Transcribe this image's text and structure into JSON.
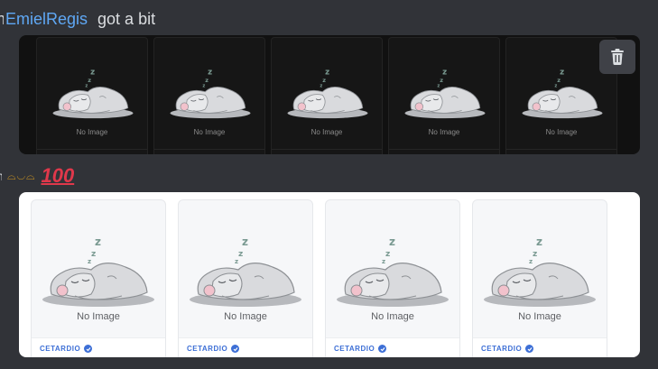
{
  "message1": {
    "fragment": "n",
    "mention": "EmielRegis",
    "text": "got a bit"
  },
  "dark_embed": {
    "cards": [
      {
        "no_image": "No Image"
      },
      {
        "no_image": "No Image"
      },
      {
        "no_image": "No Image"
      },
      {
        "no_image": "No Image"
      },
      {
        "no_image": "No Image"
      }
    ],
    "delete_icon": "trash-icon"
  },
  "message2": {
    "fragment": "n",
    "emote": "⌓◡⌓",
    "emoji": "💯",
    "emoji_fallback": "100"
  },
  "light_embed": {
    "cards": [
      {
        "no_image": "No Image",
        "brand": "CETARDIO"
      },
      {
        "no_image": "No Image",
        "brand": "CETARDIO"
      },
      {
        "no_image": "No Image",
        "brand": "CETARDIO"
      },
      {
        "no_image": "No Image",
        "brand": "CETARDIO"
      }
    ]
  },
  "colors": {
    "background": "#313338",
    "mention": "#5fa8f5",
    "brand_blue": "#3d6fd6",
    "emoji_red": "#e0384b"
  }
}
